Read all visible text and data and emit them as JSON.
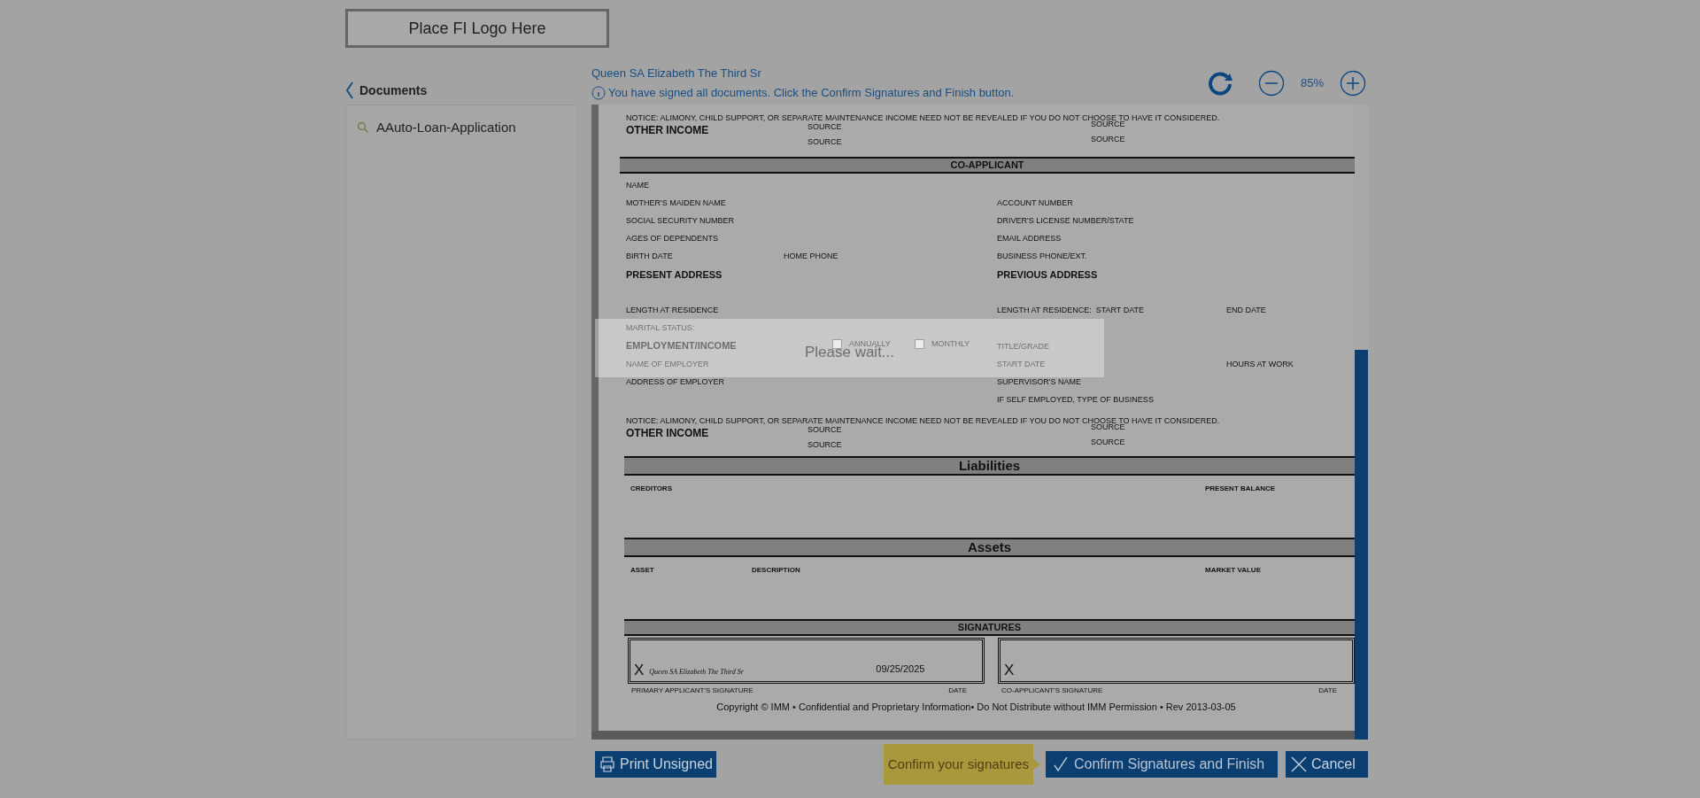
{
  "logo": {
    "text": "Place FI Logo Here"
  },
  "sidebar": {
    "title": "Documents",
    "documents": [
      {
        "name": "AAuto-Loan-Application"
      }
    ]
  },
  "viewer": {
    "signer_name": "Queen SA Elizabeth The Third Sr",
    "info": "You have signed all documents. Click the Confirm Signatures and Finish button.",
    "zoom_level": "85%"
  },
  "document": {
    "top_notice": "NOTICE: ALIMONY, CHILD SUPPORT, OR SEPARATE MAINTENANCE INCOME NEED NOT BE REVEALED IF YOU DO NOT CHOOSE TO HAVE IT CONSIDERED.",
    "top_income": {
      "label": "OTHER INCOME",
      "sources": [
        [
          "SOURCE",
          "SOURCE"
        ],
        [
          "SOURCE",
          "SOURCE"
        ]
      ]
    },
    "co_applicant": {
      "title": "CO-APPLICANT",
      "rows": [
        {
          "kind": "label",
          "left": "NAME"
        },
        {
          "kind": "label",
          "left": "MOTHER'S MAIDEN NAME",
          "right": "ACCOUNT NUMBER"
        },
        {
          "kind": "label",
          "left": "SOCIAL SECURITY NUMBER",
          "right": "DRIVER'S LICENSE NUMBER/STATE"
        },
        {
          "kind": "label",
          "left": "AGES OF DEPENDENTS",
          "right": "EMAIL ADDRESS"
        },
        {
          "kind": "label",
          "left": "BIRTH DATE",
          "mid": "HOME PHONE",
          "right": "BUSINESS PHONE/EXT."
        },
        {
          "kind": "heading",
          "left": "PRESENT ADDRESS",
          "right": "PREVIOUS ADDRESS"
        },
        {
          "kind": "label",
          "left": "LENGTH AT RESIDENCE",
          "right": "LENGTH AT RESIDENCE:  START DATE",
          "far": "END DATE"
        },
        {
          "kind": "label",
          "left": "MARITAL STATUS:"
        },
        {
          "kind": "employment",
          "left": "EMPLOYMENT/INCOME",
          "options": [
            {
              "label": "ANNUALLY",
              "checked": false
            },
            {
              "label": "MONTHLY",
              "checked": false
            }
          ],
          "right": "TITLE/GRADE"
        },
        {
          "kind": "label",
          "left": "NAME OF EMPLOYER",
          "right": "START DATE",
          "far": "HOURS AT WORK"
        },
        {
          "kind": "label",
          "left": "ADDRESS OF EMPLOYER",
          "right": "SUPERVISOR'S NAME"
        },
        {
          "kind": "label",
          "right": "IF SELF EMPLOYED, TYPE OF BUSINESS"
        }
      ]
    },
    "notice": "NOTICE: ALIMONY, CHILD SUPPORT, OR SEPARATE MAINTENANCE INCOME NEED NOT BE REVEALED IF YOU DO NOT CHOOSE TO HAVE IT CONSIDERED.",
    "other_income": {
      "label": "OTHER INCOME",
      "sources": [
        [
          "SOURCE",
          "SOURCE"
        ],
        [
          "SOURCE",
          "SOURCE"
        ]
      ]
    },
    "liabilities": {
      "title": "Liabilities",
      "columns": [
        "CREDITORS",
        "PRESENT BALANCE"
      ]
    },
    "assets": {
      "title": "Assets",
      "columns": [
        "ASSET",
        "DESCRIPTION",
        "MARKET VALUE"
      ]
    },
    "signatures": {
      "title": "SIGNATURES",
      "boxes": [
        {
          "mark": "X",
          "signature": "Queen SA Elizabeth The Third Sr",
          "date": "09/25/2025",
          "label": "PRIMARY APPLICANT'S SIGNATURE",
          "date_label": "DATE"
        },
        {
          "mark": "X",
          "label": "CO-APPLICANT'S SIGNATURE",
          "date_label": "DATE"
        }
      ]
    },
    "copyright": "Copyright © IMM • Confidential and Proprietary Information• Do Not Distribute without IMM Permission • Rev 2013-03-05"
  },
  "loading": {
    "message": "Please wait..."
  },
  "actions": {
    "print": "Print Unsigned",
    "tooltip": "Confirm your signatures",
    "confirm": "Confirm Signatures and Finish",
    "cancel": "Cancel"
  }
}
